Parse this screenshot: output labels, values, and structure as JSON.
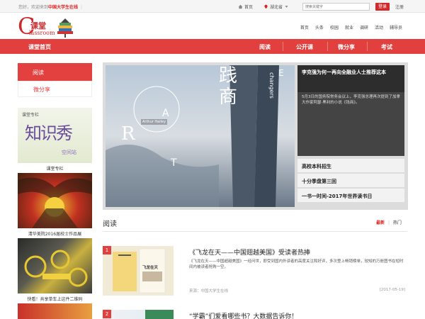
{
  "topbar": {
    "welcome": "您好，欢迎来到",
    "site_name": "中国大学生在线",
    "home": "首页",
    "location": "湖北省",
    "search_placeholder": "搜索关键字",
    "login": "登录",
    "register": "注册"
  },
  "logo": {
    "c": "C",
    "ketang": "课堂",
    "lassroom": "lassroom"
  },
  "header_nav": [
    "首页",
    "头条",
    "校园",
    "就业",
    "调研",
    "活动",
    "辅导员"
  ],
  "red_nav": {
    "home": "课堂首页",
    "items": [
      "阅读",
      "公开课",
      "微分享",
      "考试"
    ]
  },
  "sidebar": {
    "menu": [
      "阅读",
      "微分享"
    ],
    "cards": [
      {
        "caption": "课堂专栏",
        "overlay_top": "课堂专栏",
        "overlay_big": "知识秀",
        "overlay_small": "空间站"
      },
      {
        "caption": "清华美院2016届校士作品展"
      },
      {
        "caption": "快看！共享单车上这件二维码"
      }
    ]
  },
  "slideshow": {
    "art_letters": [
      "R",
      "A",
      "T",
      "E"
    ],
    "art_cn": "践商",
    "art_en": "changers",
    "badge": "Arthur Hailey",
    "title": "李克强为何一再向全融业人士推荐这本",
    "description": "5月3日的国务院常务会议上，李克强总理再次提到了加拿大作家阿瑟·黑利的小说《钱商》。",
    "list": [
      "高校本科招生",
      "十分季盘第三回",
      "一书一时间-2017年世界读书日"
    ]
  },
  "reading": {
    "title": "阅读",
    "latest": "最新",
    "sep": "|",
    "popular": "热门",
    "articles": [
      {
        "num": "1",
        "title": "《飞龙在天——中国翅越美国》受读者热捧",
        "summary": "《飞龙在天——中国超越美国》一经问世，即受到国内外读者的高度关注和好评，多次登上畅销榜单，较知的万册图书在短时间内被读者抢购一空。",
        "source": "来源：中国大学生在线",
        "date": "[2017-05-19]",
        "book_title": "飞龙在天"
      },
      {
        "num": "2",
        "title": "“学霸”们爱看哪些书？大数据告诉你！",
        "summary": "",
        "source": "",
        "date": ""
      }
    ]
  },
  "colors": {
    "brand_red": "#e23f3f",
    "dark": "#2d2d2d"
  }
}
